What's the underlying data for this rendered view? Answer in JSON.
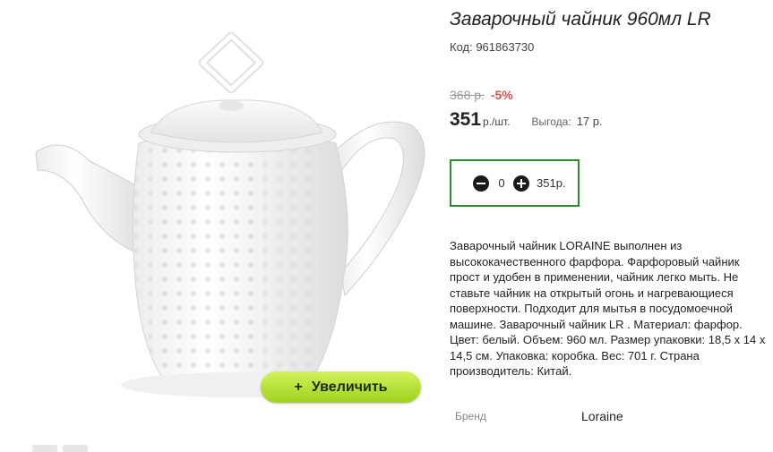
{
  "product": {
    "title": "Заварочный чайник 960мл LR",
    "code": "Код: 961863730",
    "old_price": "368 р.",
    "discount": "-5%",
    "price": "351",
    "price_unit": "р./шт.",
    "saving_label": "Выгода:",
    "saving_value": "17 р.",
    "quantity": "0",
    "sum": "351р.",
    "description": "Заварочный чайник LORAINE выполнен из высококачественного фарфора. Фарфоровый чайник прост и удобен в применении, чайник легко мыть. Не ставьте чайник на открытый огонь и нагревающиеся поверхности. Подходит для мытья в посудомоечной машине. Заварочный чайник LR . Материал: фарфор. Цвет: белый. Объем: 960 мл. Размер упаковки: 18,5 х 14 х 14,5 см. Упаковка: коробка. Вес: 701 г. Страна производитель: Китай.",
    "brand_label": "Бренд",
    "brand_value": "Loraine"
  },
  "image": {
    "zoom_icon": "+",
    "zoom_label": "Увеличить",
    "zoom_button_color": "#a8d82a"
  },
  "colors": {
    "cart_border": "#2e8b2e",
    "discount": "#d9534f"
  },
  "icons": {
    "minus": "minus-circle-icon",
    "plus": "plus-circle-icon"
  }
}
